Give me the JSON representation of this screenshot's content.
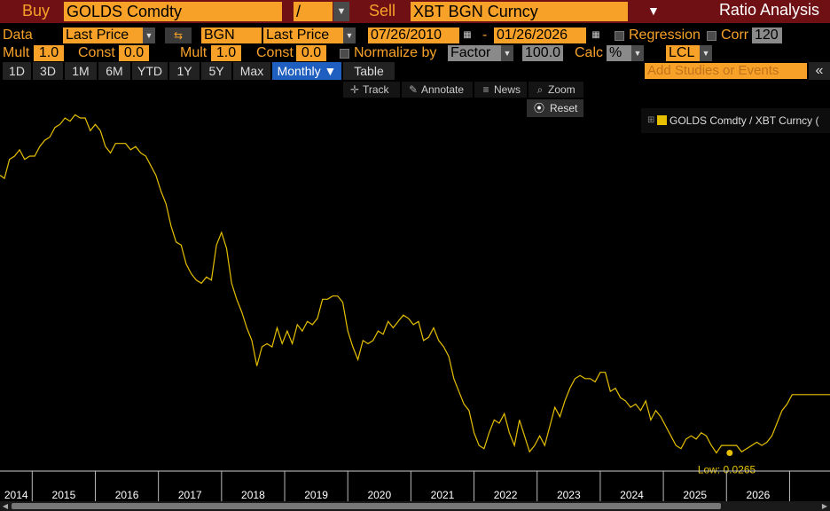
{
  "header": {
    "buy_label": "Buy",
    "buy_ticker": "GOLDS Comdty",
    "operator": "/",
    "sell_label": "Sell",
    "sell_ticker": "XBT BGN Curncy",
    "title": "Ratio Analysis"
  },
  "row2": {
    "data_label": "Data",
    "price_field_1": "Last Price",
    "source": "BGN",
    "price_field_2": "Last Price",
    "start_date": "07/26/2010",
    "dash": "-",
    "end_date": "01/26/2026",
    "regression_label": "Regression",
    "corr_label": "Corr",
    "corr_value": "120"
  },
  "row3": {
    "mult_label_1": "Mult",
    "mult_value_1": "1.0",
    "const_label_1": "Const",
    "const_value_1": "0.0",
    "mult_label_2": "Mult",
    "mult_value_2": "1.0",
    "const_label_2": "Const",
    "const_value_2": "0.0",
    "normalize_label": "Normalize by",
    "normalize_value": "Factor",
    "factor_value": "100.0",
    "calc_label": "Calc",
    "calc_value": "%",
    "currency_value": "LCL"
  },
  "periods": [
    "1D",
    "3D",
    "1M",
    "6M",
    "YTD",
    "1Y",
    "5Y",
    "Max"
  ],
  "frequency": "Monthly ▼",
  "table_label": "Table",
  "studies_placeholder": "Add Studies or Events",
  "collapse_icon": "«",
  "toolbar": {
    "track": "Track",
    "annotate": "Annotate",
    "news": "News",
    "zoom": "Zoom",
    "reset": "Reset"
  },
  "legend": {
    "label": "GOLDS Comdty / XBT Curncy (",
    "color": "#e6c000"
  },
  "chart_data": {
    "type": "line",
    "x_tick_labels": [
      "2014",
      "2015",
      "2016",
      "2017",
      "2018",
      "2019",
      "2020",
      "2021",
      "2022",
      "2023",
      "2024",
      "2025",
      "2026"
    ],
    "ylim": [
      0.0,
      1.2
    ],
    "series": [
      {
        "color": "#e6c000",
        "x": [
          2013.45,
          2013.52,
          2013.6,
          2013.68,
          2013.76,
          2013.84,
          2013.92,
          2014.0,
          2014.08,
          2014.16,
          2014.24,
          2014.32,
          2014.4,
          2014.48,
          2014.56,
          2014.64,
          2014.72,
          2014.8,
          2014.88,
          2014.96,
          2015.04,
          2015.12,
          2015.2,
          2015.28,
          2015.36,
          2015.44,
          2015.52,
          2015.6,
          2015.68,
          2015.76,
          2015.84,
          2015.92,
          2016.0,
          2016.08,
          2016.16,
          2016.24,
          2016.32,
          2016.4,
          2016.48,
          2016.56,
          2016.64,
          2016.72,
          2016.8,
          2016.88,
          2016.96,
          2017.04,
          2017.12,
          2017.2,
          2017.28,
          2017.36,
          2017.44,
          2017.52,
          2017.6,
          2017.68,
          2017.76,
          2017.84,
          2017.92,
          2018.0,
          2018.08,
          2018.16,
          2018.24,
          2018.32,
          2018.4,
          2018.48,
          2018.56,
          2018.64,
          2018.72,
          2018.8,
          2018.88,
          2018.96,
          2019.04,
          2019.12,
          2019.2,
          2019.28,
          2019.36,
          2019.44,
          2019.52,
          2019.6,
          2019.68,
          2019.76,
          2019.84,
          2019.92,
          2020.0,
          2020.08,
          2020.16,
          2020.24,
          2020.32,
          2020.4,
          2020.48,
          2020.56,
          2020.64,
          2020.72,
          2020.8,
          2020.88,
          2020.96,
          2021.04,
          2021.12,
          2021.2,
          2021.28,
          2021.36,
          2021.44,
          2021.52,
          2021.6,
          2021.68,
          2021.76,
          2021.84,
          2021.92,
          2022.0,
          2022.08,
          2022.16,
          2022.24,
          2022.32,
          2022.4,
          2022.48,
          2022.56,
          2022.64,
          2022.72,
          2022.8,
          2022.88,
          2022.96,
          2023.04,
          2023.12,
          2023.2,
          2023.28,
          2023.36,
          2023.44,
          2023.52,
          2023.6,
          2023.68,
          2023.76,
          2023.84,
          2023.92,
          2024.0,
          2024.08,
          2024.16,
          2024.24,
          2024.32,
          2024.4,
          2024.48,
          2024.56,
          2024.64,
          2024.72,
          2024.8,
          2024.88,
          2024.96,
          2025.04,
          2025.12,
          2025.2,
          2025.28,
          2025.36,
          2025.44,
          2025.52,
          2025.6,
          2025.68,
          2025.76,
          2025.84,
          2025.92,
          2026.0,
          2026.2,
          2026.4,
          2026.6
        ],
        "y": [
          0.9,
          0.89,
          0.95,
          0.96,
          0.98,
          0.95,
          0.96,
          0.96,
          0.99,
          1.01,
          1.02,
          1.05,
          1.06,
          1.08,
          1.07,
          1.09,
          1.08,
          1.08,
          1.04,
          1.06,
          1.04,
          0.99,
          0.97,
          1.0,
          1.0,
          1.0,
          0.98,
          0.99,
          0.97,
          0.96,
          0.93,
          0.9,
          0.85,
          0.81,
          0.74,
          0.69,
          0.68,
          0.62,
          0.59,
          0.57,
          0.56,
          0.58,
          0.57,
          0.68,
          0.72,
          0.67,
          0.56,
          0.51,
          0.47,
          0.42,
          0.38,
          0.3,
          0.36,
          0.37,
          0.36,
          0.42,
          0.37,
          0.41,
          0.37,
          0.43,
          0.41,
          0.44,
          0.43,
          0.45,
          0.51,
          0.51,
          0.52,
          0.52,
          0.5,
          0.41,
          0.36,
          0.32,
          0.38,
          0.37,
          0.38,
          0.41,
          0.4,
          0.44,
          0.42,
          0.44,
          0.46,
          0.45,
          0.43,
          0.44,
          0.38,
          0.39,
          0.42,
          0.38,
          0.36,
          0.33,
          0.26,
          0.22,
          0.18,
          0.16,
          0.09,
          0.05,
          0.04,
          0.09,
          0.13,
          0.12,
          0.15,
          0.09,
          0.05,
          0.13,
          0.08,
          0.03,
          0.05,
          0.08,
          0.05,
          0.11,
          0.17,
          0.14,
          0.19,
          0.23,
          0.26,
          0.27,
          0.26,
          0.26,
          0.25,
          0.28,
          0.28,
          0.22,
          0.23,
          0.2,
          0.19,
          0.17,
          0.18,
          0.16,
          0.19,
          0.13,
          0.16,
          0.14,
          0.11,
          0.08,
          0.05,
          0.04,
          0.07,
          0.08,
          0.07,
          0.09,
          0.08,
          0.05,
          0.0265,
          0.05,
          0.05,
          0.05,
          0.05,
          0.03,
          0.04,
          0.05,
          0.06,
          0.05,
          0.06,
          0.08,
          0.12,
          0.16,
          0.18,
          0.21,
          0.21,
          0.21,
          0.21
        ]
      }
    ],
    "annotation": {
      "text": "Low: 0.0265",
      "x": 2025.01,
      "y": 0.0265
    }
  }
}
